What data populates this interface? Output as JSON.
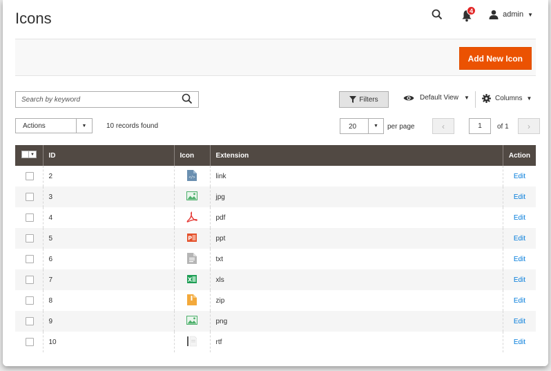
{
  "header": {
    "title": "Icons",
    "notifications_count": "4",
    "user_name": "admin"
  },
  "action_bar": {
    "add_new_label": "Add New Icon"
  },
  "toolbar": {
    "search_placeholder": "Search by keyword",
    "filters_label": "Filters",
    "view_label": "Default View",
    "columns_label": "Columns",
    "actions_label": "Actions",
    "records_found": "10 records found",
    "per_page_value": "20",
    "per_page_label": "per page",
    "current_page": "1",
    "page_of": "of 1"
  },
  "grid": {
    "columns": [
      "ID",
      "Icon",
      "Extension",
      "Action"
    ],
    "rows": [
      {
        "id": "2",
        "icon": "code-file-icon",
        "extension": "link",
        "action": "Edit"
      },
      {
        "id": "3",
        "icon": "image-file-icon",
        "extension": "jpg",
        "action": "Edit"
      },
      {
        "id": "4",
        "icon": "pdf-file-icon",
        "extension": "pdf",
        "action": "Edit"
      },
      {
        "id": "5",
        "icon": "powerpoint-file-icon",
        "extension": "ppt",
        "action": "Edit"
      },
      {
        "id": "6",
        "icon": "text-file-icon",
        "extension": "txt",
        "action": "Edit"
      },
      {
        "id": "7",
        "icon": "excel-file-icon",
        "extension": "xls",
        "action": "Edit"
      },
      {
        "id": "8",
        "icon": "zip-file-icon",
        "extension": "zip",
        "action": "Edit"
      },
      {
        "id": "9",
        "icon": "image-file-icon",
        "extension": "png",
        "action": "Edit"
      },
      {
        "id": "10",
        "icon": "rtf-file-icon",
        "extension": "rtf",
        "action": "Edit"
      }
    ]
  },
  "colors": {
    "accent": "#eb5202",
    "header_bg": "#514943",
    "link": "#007bdb",
    "badge": "#e22626"
  }
}
